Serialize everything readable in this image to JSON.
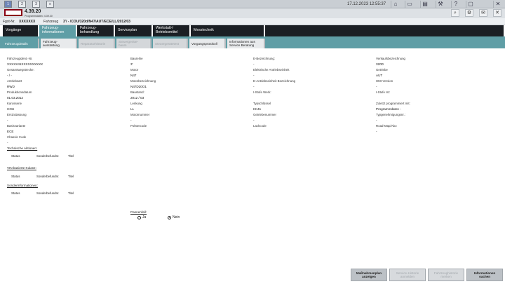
{
  "topbar": {
    "window_buttons": [
      "1",
      "2",
      "3"
    ],
    "datetime": "17.12.2023  12:55:37",
    "icons": [
      "home-icon",
      "car-icon",
      "print-icon",
      "wrench-icon",
      "help-icon",
      "window-icon",
      "close-icon"
    ]
  },
  "header": {
    "version": "4.39.20",
    "program_date_label": "Programmdaten:",
    "program_date_value": "4.39.20",
    "icons": [
      "search-icon",
      "gear-icon",
      "mail-icon",
      "close-icon"
    ]
  },
  "vehicle": {
    "fgst_label": "Fgst-Nr.",
    "fgst_value": "XXXXXXX",
    "fahrzeug_label": "Fahrzeug",
    "fahrzeug_value": "3'/ - /COU/320d/N47/AUT/ECE/LL/2012/03"
  },
  "main_tabs": [
    {
      "label": "Vorgänge"
    },
    {
      "label": "Fahrzeug-\ninformationen"
    },
    {
      "label": "Fahrzeug-\nbehandlung"
    },
    {
      "label": "Serviceplan"
    },
    {
      "label": "Werkstatt-/\nBetriebsmittel"
    },
    {
      "label": "Messtechnik"
    }
  ],
  "sub_tabs": [
    {
      "label": "Fahrzeugdetails"
    },
    {
      "label": "Fahrzeug-\nausstattung"
    },
    {
      "label": "Reparaturhistorie"
    },
    {
      "label": "Steuergeräte-\nbaum"
    },
    {
      "label": "Steuergerätetest"
    },
    {
      "label": "Vorgangsprotokoll"
    },
    {
      "label": "Informationen aus\nService Beratung"
    }
  ],
  "fields": {
    "fahrzeugident": {
      "label": "Fahrzeugident.-Nr.",
      "value": "XXXXX41XXXXXXXXXX"
    },
    "baureihe": {
      "label": "Baureihe",
      "value": "3'"
    },
    "e_bezeichnung": {
      "label": "E-Bezeichnung:",
      "value": "-"
    },
    "verkaufsbezeichnung": {
      "label": "Verkaufsbezeichnung",
      "value": "320D"
    },
    "gesamtwegstrecke": {
      "label": "Gesamtwegstrecke:",
      "value": "- / -"
    },
    "motor": {
      "label": "Motor",
      "value": "N47"
    },
    "el_antriebseinheit": {
      "label": "Elektrische Antriebseinheit",
      "value": "-"
    },
    "getriebe": {
      "label": "Getriebe",
      "value": "AUT"
    },
    "antriebsart": {
      "label": "Antriebsart",
      "value": "RWD"
    },
    "motorbezeichnung": {
      "label": "Motorbezeichnung",
      "value": "N47D20O1"
    },
    "e_antriebseinheit_bez": {
      "label": "E-Antriebseinheit Bezeichnung",
      "value": "-"
    },
    "hmi_version": {
      "label": "HMI-Version",
      "value": "-"
    },
    "produktionsdatum": {
      "label": "Produktionsdatum",
      "value": "01.03.2012"
    },
    "baustand": {
      "label": "Baustand:",
      "value": "2012 / 03"
    },
    "istufe_werk": {
      "label": "I-Stufe Werk:",
      "value": ""
    },
    "istufe_ist": {
      "label": "I-Stufe Ist:",
      "value": ""
    },
    "karosserie": {
      "label": "Karosserie",
      "value": "COU"
    },
    "lenkung": {
      "label": "Lenkung",
      "value": "LL"
    },
    "typschluessel": {
      "label": "Typschlüssel",
      "value": "KK41"
    },
    "zuletzt_programmiert": {
      "label": "Zuletzt programmiert mit:",
      "value": "Programmdaten -"
    },
    "erstzulassung": {
      "label": "Erstzulassung",
      "value": "-"
    },
    "motornummer": {
      "label": "Motornummer",
      "value": "-"
    },
    "getriebenummer": {
      "label": "Getriebenummer",
      "value": "-"
    },
    "typgenehmigung": {
      "label": "Typgenehmigungsnr.:",
      "value": "-"
    },
    "basisvariante": {
      "label": "Basisvariante",
      "value": "ECE"
    },
    "polstercode": {
      "label": "Polstercode",
      "value": ""
    },
    "lackcode": {
      "label": "Lackcode",
      "value": ""
    },
    "road_map": {
      "label": "Road-Map/Abo",
      "value": "-"
    },
    "chassis_code": {
      "label": "Chassis Code",
      "value": "-"
    }
  },
  "sections": [
    {
      "title": "Technische Aktionen:",
      "columns": [
        "Status",
        "Sonderbefundnr.",
        "Titel"
      ]
    },
    {
      "title": "VIN basierte Kulanz:",
      "columns": [
        "Status",
        "Sonderbefundnr.",
        "Titel"
      ]
    },
    {
      "title": "Sonderinformationen:",
      "columns": [
        "Status",
        "Sonderbefundnr.",
        "Titel"
      ]
    }
  ],
  "pannenfall": {
    "label": "Pannenfall:",
    "options": [
      "Ja",
      "Nein"
    ],
    "selected": "Nein"
  },
  "bottom_buttons": [
    {
      "label": "Maßnahmenplan\nanzeigen",
      "enabled": true
    },
    {
      "label": "Service-Historie\nanmelden",
      "enabled": false
    },
    {
      "label": "Fahrzeughistorie\nmerken",
      "enabled": false
    },
    {
      "label": "Informationen\nsuchen",
      "enabled": true
    }
  ]
}
